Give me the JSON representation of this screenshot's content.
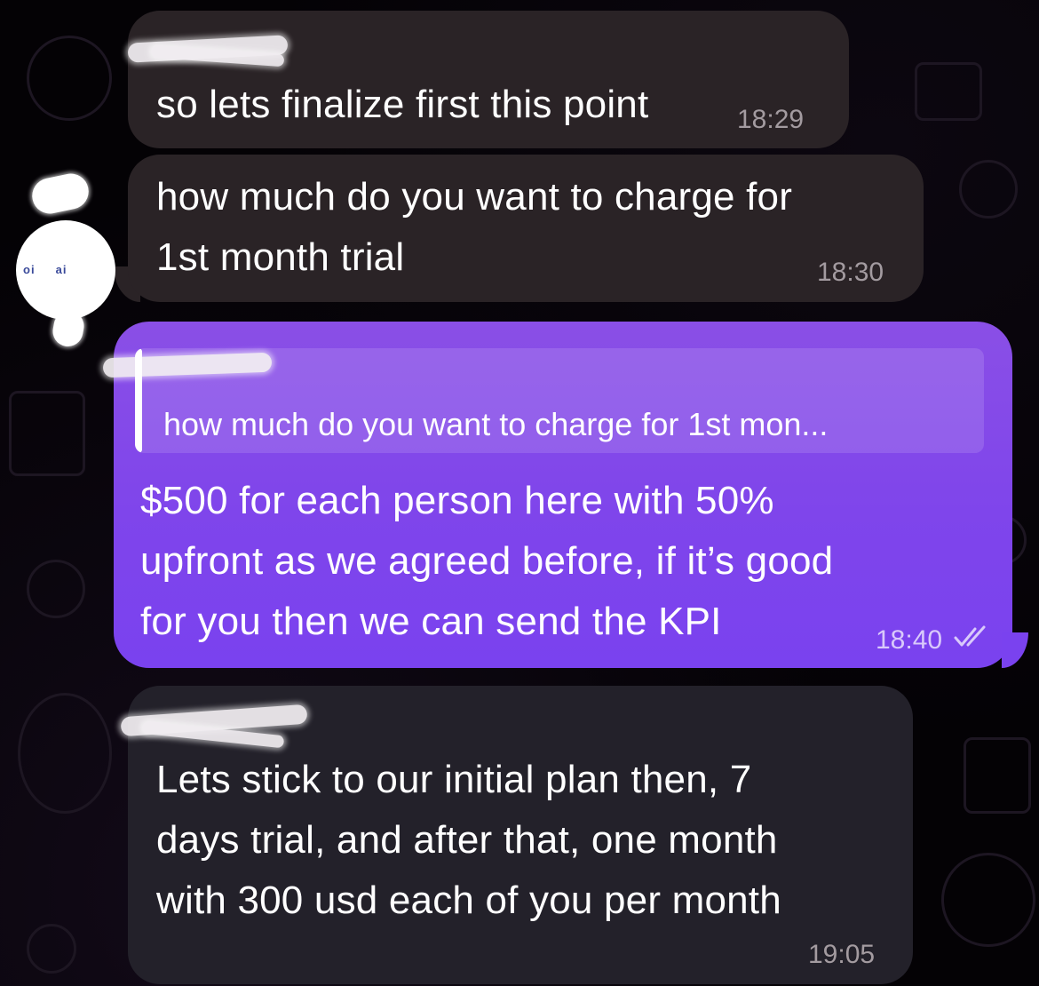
{
  "chat": {
    "messages": [
      {
        "direction": "incoming",
        "text": "so lets finalize first this point",
        "time": "18:29"
      },
      {
        "direction": "incoming",
        "text": "how much do you want to charge for\n1st month trial",
        "time": "18:30"
      },
      {
        "direction": "outgoing",
        "reply_to": "how much do you want to charge for 1st mon...",
        "text": "$500 for each person here with 50%\nupfront as we agreed before, if it’s good\nfor you then we can send the KPI",
        "time": "18:40",
        "status_icon": "double-check-read-icon"
      },
      {
        "direction": "incoming",
        "text": "Lets stick to our initial plan then, 7\ndays trial, and after that, one month\nwith 300 usd each of you per month",
        "time": "19:05"
      }
    ]
  },
  "colors": {
    "background": "#040205",
    "incoming_bubble": "#2a2326",
    "outgoing_bubble": "#7f45eb",
    "timestamp_incoming": "#a39ba0",
    "timestamp_outgoing": "#d9c9fb"
  }
}
